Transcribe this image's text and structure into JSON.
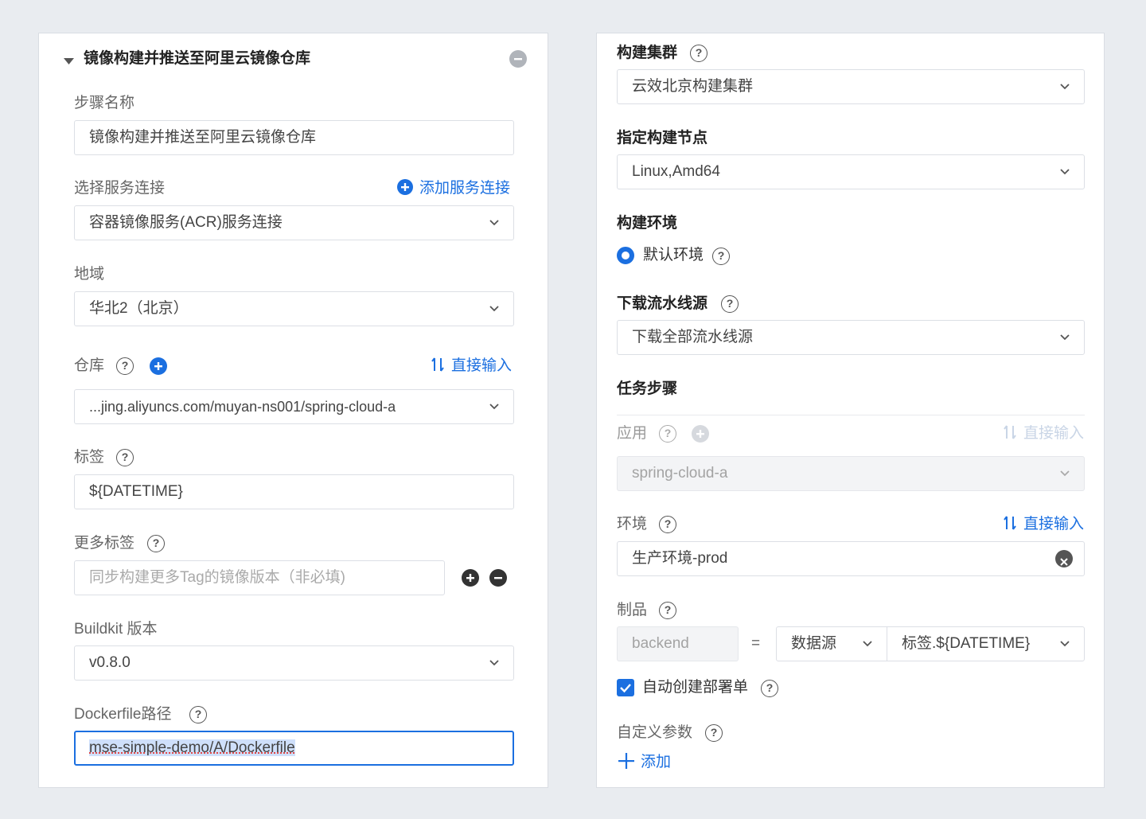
{
  "left": {
    "section_title": "镜像构建并推送至阿里云镜像仓库",
    "step_name": {
      "label": "步骤名称",
      "value": "镜像构建并推送至阿里云镜像仓库"
    },
    "service_connection": {
      "label": "选择服务连接",
      "add_link": "添加服务连接",
      "value": "容器镜像服务(ACR)服务连接"
    },
    "region": {
      "label": "地域",
      "value": "华北2（北京）"
    },
    "repository": {
      "label": "仓库",
      "direct_input": "直接输入",
      "value": "...jing.aliyuncs.com/muyan-ns001/spring-cloud-a"
    },
    "tag": {
      "label": "标签",
      "value": "${DATETIME}"
    },
    "more_tags": {
      "label": "更多标签",
      "placeholder": "同步构建更多Tag的镜像版本（非必填)"
    },
    "buildkit": {
      "label": "Buildkit 版本",
      "value": "v0.8.0"
    },
    "dockerfile": {
      "label": "Dockerfile路径",
      "value": "mse-simple-demo/A/Dockerfile"
    }
  },
  "right": {
    "build_cluster": {
      "label": "构建集群",
      "value": "云效北京构建集群"
    },
    "build_node": {
      "label": "指定构建节点",
      "value": "Linux,Amd64"
    },
    "build_env": {
      "label": "构建环境",
      "option": "默认环境"
    },
    "download_source": {
      "label": "下载流水线源",
      "value": "下载全部流水线源"
    },
    "task_steps": {
      "label": "任务步骤"
    },
    "application": {
      "label": "应用",
      "direct_input": "直接输入",
      "value": "spring-cloud-a"
    },
    "environment": {
      "label": "环境",
      "direct_input": "直接输入",
      "value": "生产环境-prod"
    },
    "artifact": {
      "label": "制品",
      "name": "backend",
      "equals": "=",
      "source": "数据源",
      "tag": "标签.${DATETIME}"
    },
    "auto_create": {
      "label": "自动创建部署单",
      "checked": true
    },
    "custom_params": {
      "label": "自定义参数",
      "add": "添加"
    }
  },
  "colors": {
    "accent": "#1b6fe0",
    "background": "#e9ecf0"
  }
}
